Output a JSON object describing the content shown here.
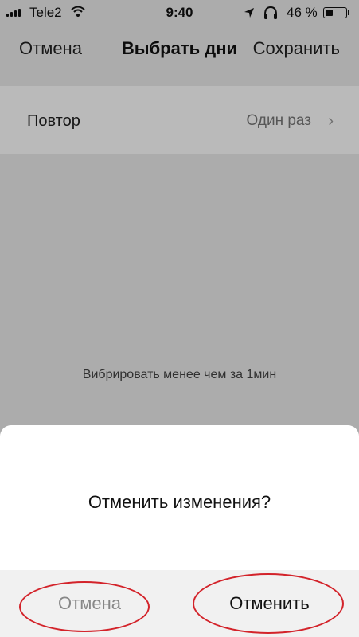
{
  "status_bar": {
    "carrier": "Tele2",
    "time": "9:40",
    "battery": "46 %",
    "battery_level": 0.46
  },
  "nav": {
    "cancel": "Отмена",
    "title": "Выбрать дни",
    "save": "Сохранить"
  },
  "repeat": {
    "label": "Повтор",
    "value": "Один раз"
  },
  "vibrate_text": "Вибрировать менее чем за 1мин",
  "dialog": {
    "question": "Отменить изменения?",
    "cancel": "Отмена",
    "confirm": "Отменить"
  },
  "colors": {
    "highlight": "#d3232a"
  }
}
